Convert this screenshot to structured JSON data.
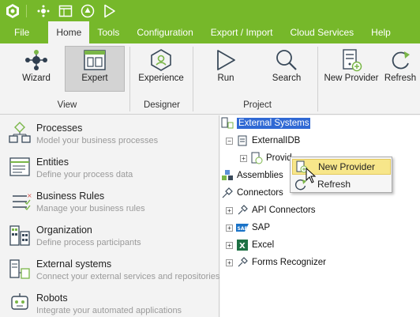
{
  "menu": {
    "items": [
      "File",
      "Home",
      "Tools",
      "Configuration",
      "Export / Import",
      "Cloud Services",
      "Help"
    ],
    "active": "Home"
  },
  "ribbon": {
    "view": {
      "label": "View",
      "wizard": "Wizard",
      "expert": "Expert"
    },
    "designer": {
      "label": "Designer",
      "experience": "Experience"
    },
    "project": {
      "label": "Project",
      "run": "Run",
      "search": "Search",
      "new_provider": "New Provider",
      "refresh": "Refresh"
    }
  },
  "left_panel": {
    "items": [
      {
        "title": "Processes",
        "subtitle": "Model your business processes",
        "icon": "processes-icon"
      },
      {
        "title": "Entities",
        "subtitle": "Define your process data",
        "icon": "entities-icon"
      },
      {
        "title": "Business Rules",
        "subtitle": "Manage your business rules",
        "icon": "business-rules-icon"
      },
      {
        "title": "Organization",
        "subtitle": "Define process participants",
        "icon": "organization-icon"
      },
      {
        "title": "External systems",
        "subtitle": "Connect your external services and repositories",
        "icon": "external-systems-icon"
      },
      {
        "title": "Robots",
        "subtitle": "Integrate your automated applications",
        "icon": "robots-icon"
      }
    ]
  },
  "tree": {
    "root": "External Systems",
    "external_db": "ExternalIDB",
    "providers": "Provid",
    "assemblies": "Assemblies",
    "connectors": "Connectors",
    "api_connectors": "API Connectors",
    "sap": "SAP",
    "excel": "Excel",
    "forms_recognizer": "Forms Recognizer"
  },
  "context_menu": {
    "new_provider": "New Provider",
    "refresh": "Refresh"
  },
  "colors": {
    "accent": "#76b82a",
    "selection": "#3069d4",
    "highlight": "#f7e68a"
  }
}
